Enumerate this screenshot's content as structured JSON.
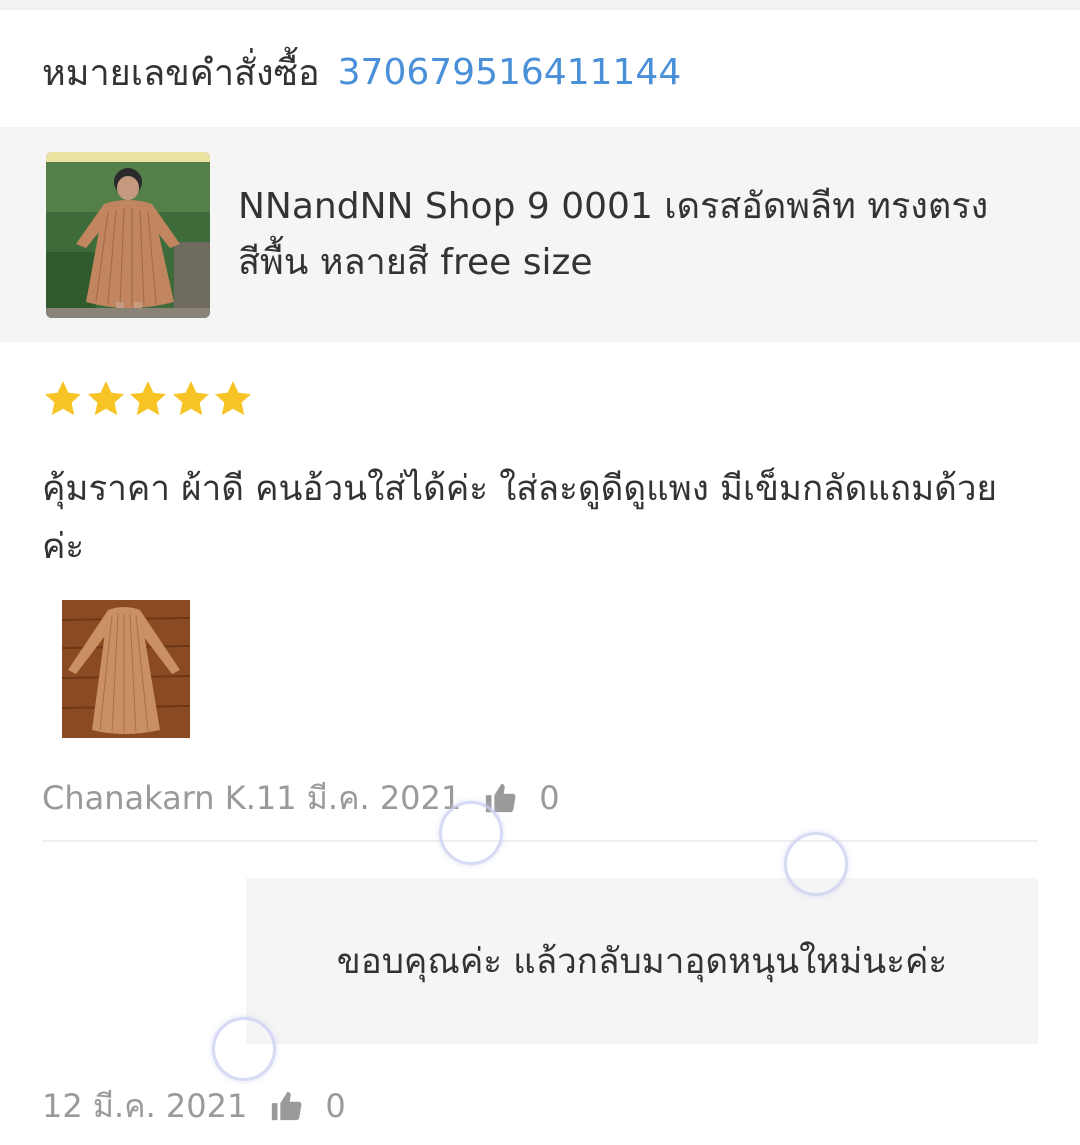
{
  "order": {
    "label": "หมายเลขคำสั่งซื้อ",
    "number": "370679516411144"
  },
  "product": {
    "title": "NNandNN Shop 9 0001 เดรสอัดพลีท ทรงตรง สีพื้น หลายสี free size",
    "thumbnail_icon": "product-photo"
  },
  "review": {
    "rating": 5,
    "max_rating": 5,
    "text": "คุ้มราคา ผ้าดี คนอ้วนใส่ได้ค่ะ ใส่ละดูดีดูแพง มีเข็มกลัดแถมด้วยค่ะ",
    "photo_icon": "dress-photo",
    "author_date": "Chanakarn K.11 มี.ค. 2021",
    "like_count": "0"
  },
  "reply": {
    "text": "ขอบคุณค่ะ แล้วกลับมาอุดหนุนใหม่นะค่ะ",
    "date": "12 มี.ค. 2021",
    "like_count": "0"
  },
  "colors": {
    "accent_link": "#4a90d9",
    "star": "#f7c325",
    "muted_text": "#9a9a9a",
    "card_bg": "#f5f5f5"
  }
}
